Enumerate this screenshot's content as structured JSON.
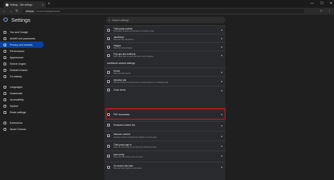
{
  "browser": {
    "tab_title": "Settings - Site settings",
    "tab_close": "×",
    "new_tab": "+",
    "window_controls": [
      "—",
      "☐",
      "✕"
    ],
    "nav": {
      "back": "←",
      "forward": "→",
      "reload": "↻"
    },
    "chip": "Chrome",
    "url": "chrome://settings/content",
    "toolbar_icons": [
      "☆",
      "⋮"
    ]
  },
  "app": {
    "title": "Settings",
    "search_placeholder": "Search settings"
  },
  "sidebar": {
    "items": [
      {
        "label": "You and Google",
        "active": false
      },
      {
        "label": "Autofill and passwords",
        "active": false
      },
      {
        "label": "Privacy and security",
        "active": true
      },
      {
        "label": "Performance",
        "active": false
      },
      {
        "label": "Appearance",
        "active": false
      },
      {
        "label": "Search engine",
        "active": false
      },
      {
        "label": "Default browser",
        "active": false
      },
      {
        "label": "On startup",
        "active": false
      },
      {
        "label": "Languages",
        "active": false
      },
      {
        "label": "Downloads",
        "active": false
      },
      {
        "label": "Accessibility",
        "active": false
      },
      {
        "label": "System",
        "active": false
      },
      {
        "label": "Reset settings",
        "active": false
      },
      {
        "label": "Extensions",
        "active": false
      },
      {
        "label": "About Chrome",
        "active": false
      }
    ]
  },
  "main": {
    "rows_top": [
      {
        "title": "Third-party cookies",
        "sub": "Third-party cookies are blocked in Incognito mode"
      },
      {
        "title": "JavaScript",
        "sub": "Sites can use JavaScript"
      },
      {
        "title": "Images",
        "sub": "Sites can show images"
      },
      {
        "title": "Pop-ups and redirects",
        "sub": "Don't allow sites to send pop-ups or use redirects"
      }
    ],
    "section_title": "Additional content settings",
    "rows_bottom": [
      {
        "title": "Sound",
        "sub": "Sites can play sound"
      },
      {
        "title": "Intrusive ads",
        "sub": "Ads are blocked on sites known to show intrusive or misleading ads"
      },
      {
        "title": "Zoom levels",
        "sub": ""
      },
      {
        "title": "PDF documents",
        "sub": ""
      },
      {
        "title": "Protected content IDs",
        "sub": ""
      },
      {
        "title": "Insecure content",
        "sub": "Insecure content is blocked by default on secure sites"
      },
      {
        "title": "Third-party sign-in",
        "sub": "Sites can show sign-in prompts from identity services"
      },
      {
        "title": "Auto-verify",
        "sub": "Sites can help verify you're not a bot"
      },
      {
        "title": "On-device site data",
        "sub": "Sites can save data on your device"
      }
    ],
    "chevron": "▸"
  },
  "colors": {
    "highlight": "#e0141e",
    "active_nav": "#0842a0"
  }
}
